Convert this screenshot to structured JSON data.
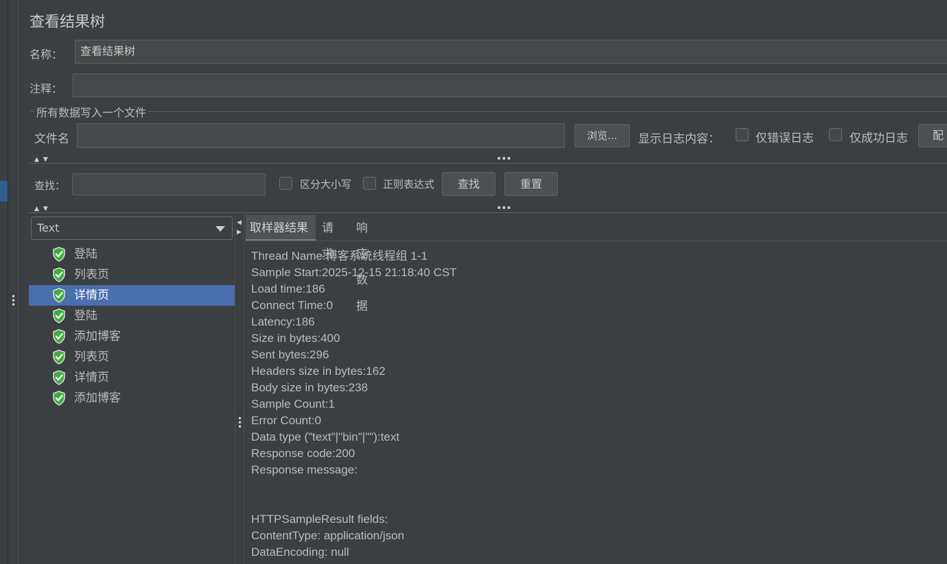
{
  "title": "查看结果树",
  "name_label": "名称：",
  "name_value": "查看结果树",
  "comment_label": "注释：",
  "comment_value": "",
  "file_group_title": "所有数据写入一个文件",
  "filename_label": "文件名",
  "filename_value": "",
  "browse_button": "浏览...",
  "log_display_label": "显示日志内容：",
  "errors_only_label": "仅错误日志",
  "success_only_label": "仅成功日志",
  "configure_button": "配",
  "search_label": "查找：",
  "search_value": "",
  "case_sensitive_label": "区分大小写",
  "regex_label": "正则表达式",
  "find_button": "查找",
  "reset_button": "重置",
  "renderer_select": "Text",
  "tree_items": [
    {
      "label": "登陆",
      "status": "success"
    },
    {
      "label": "列表页",
      "status": "success"
    },
    {
      "label": "详情页",
      "status": "success",
      "selected": true
    },
    {
      "label": "登陆",
      "status": "success"
    },
    {
      "label": "添加博客",
      "status": "success"
    },
    {
      "label": "列表页",
      "status": "success"
    },
    {
      "label": "详情页",
      "status": "success"
    },
    {
      "label": "添加博客",
      "status": "success"
    }
  ],
  "tabs": [
    "取样器结果",
    "请求",
    "响应数据"
  ],
  "active_tab": "取样器结果",
  "result_lines": [
    "Thread Name:博客系统线程组 1-1",
    "Sample Start:2025-12-15 21:18:40 CST",
    "Load time:186",
    "Connect Time:0",
    "Latency:186",
    "Size in bytes:400",
    "Sent bytes:296",
    "Headers size in bytes:162",
    "Body size in bytes:238",
    "Sample Count:1",
    "Error Count:0",
    "Data type (\"text\"|\"bin\"|\"\"):text",
    "Response code:200",
    "Response message:",
    "",
    "",
    "HTTPSampleResult fields:",
    "ContentType: application/json",
    "DataEncoding: null"
  ],
  "colors": {
    "background": "#3c3f41",
    "selection": "#4b6eaf",
    "success_icon": "#3fae3f"
  },
  "icons": {
    "success": "shield-check-icon"
  }
}
